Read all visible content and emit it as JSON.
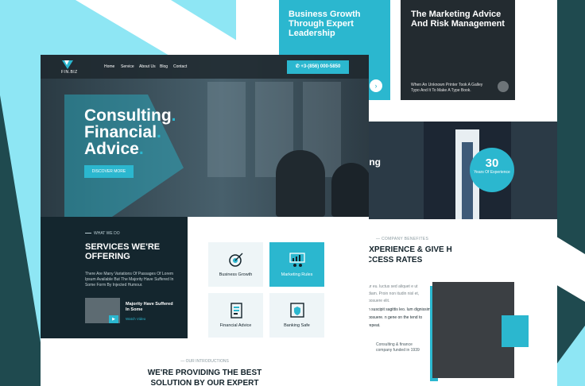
{
  "colors": {
    "accent": "#2bb7cf",
    "dark": "#14262e",
    "bg_teal": "#1f4a4f",
    "light_bg": "#8ee6f4"
  },
  "back": {
    "card1": {
      "title": "Business Growth Through Expert Leadership",
      "arrow": "›"
    },
    "card2": {
      "title": "The Marketing Advice And Risk Management",
      "text": "When An Unknown Printer Took A Galley Typo And It To Make A Type Book."
    },
    "hero_partial": "ing",
    "badge": {
      "number": "30",
      "label": "Years Of Experience"
    },
    "kicker": "— COMPANY BENEFITES",
    "heading": "G EXPERIENCE & GIVE H SUCCESS RATES",
    "para": "ur eu. luctus sed aliquet e ut diam. Proin non itudin nisl et, posuere elit.",
    "bullets": "n suscipit sagittis leo. lum dignissim posuere. n gene on the tend to repeat.",
    "quote": "Consulting & finance company funded in 1939"
  },
  "front": {
    "logo_text": "FIN.BIZ",
    "nav": [
      "Home",
      "Service",
      "About Us",
      "Blog",
      "Contact"
    ],
    "phone": "+3-(856) 000-5850",
    "phone_icon": "phone-icon",
    "hero_lines": [
      "Consulting",
      "Financial",
      "Advice"
    ],
    "hero_dot": ".",
    "cta": "DISCOVER MORE",
    "services": {
      "kicker": "WHAT WE DO",
      "title": "SERVICES WE'RE OFFERING",
      "text": "There Are Many Variations Of Passages Of Lorem Ipsum Available But The Majority Have Suffered In Some Form By Injected Humour.",
      "video_title": "Majority Have Suffered In Some",
      "video_link": "Watch Video"
    },
    "boxes": [
      {
        "label": "Business Growth",
        "icon": "target-icon"
      },
      {
        "label": "Marketing Rules",
        "icon": "chart-icon"
      },
      {
        "label": "Financial Advice",
        "icon": "document-icon"
      },
      {
        "label": "Banking Safe",
        "icon": "safe-icon"
      }
    ],
    "intro": {
      "kicker": "— OUR INTRODUCTIONS",
      "title": "WE'RE PROVIDING THE BEST SOLUTION BY OUR EXPERT"
    }
  }
}
